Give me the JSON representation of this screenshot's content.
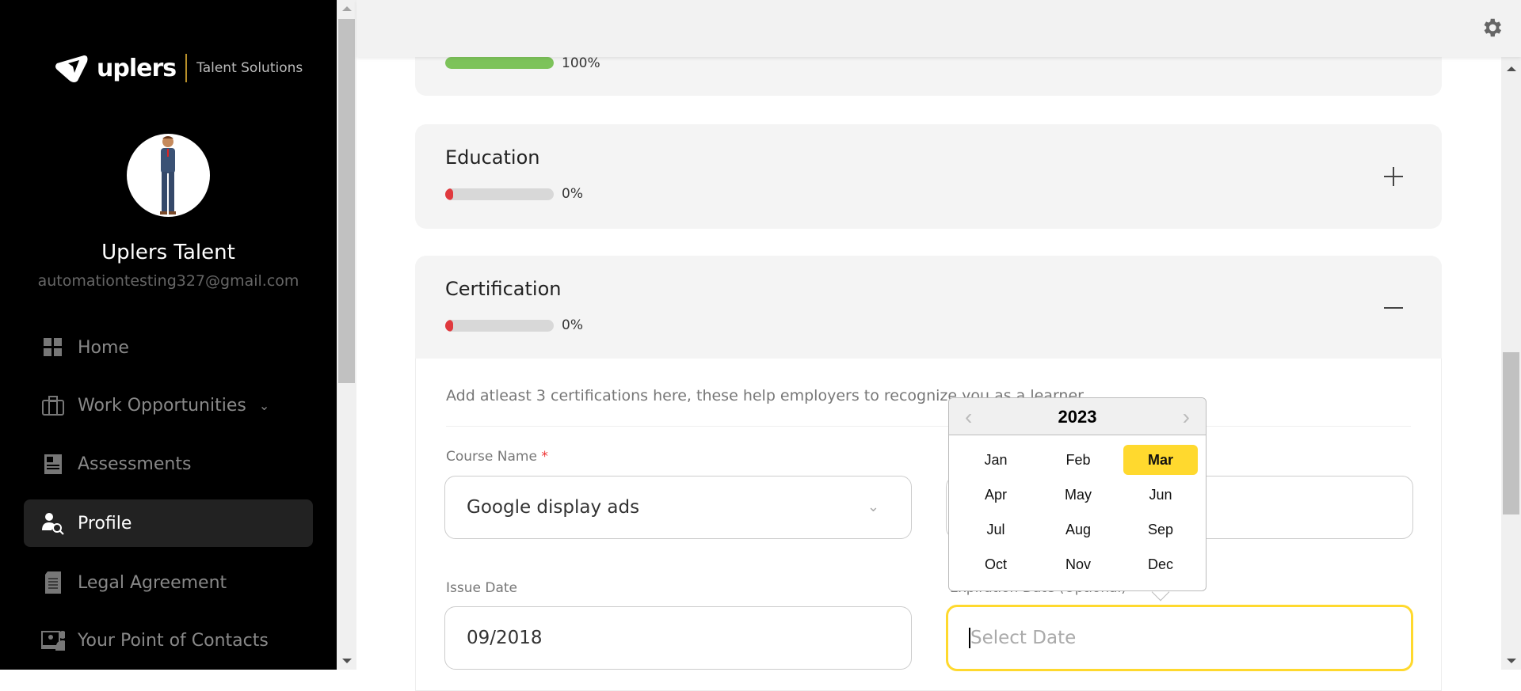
{
  "brand": {
    "name": "uplers",
    "tagline": "Talent Solutions"
  },
  "user": {
    "name": "Uplers Talent",
    "email": "automationtesting327@gmail.com"
  },
  "sidebar": {
    "items": [
      {
        "label": "Home",
        "icon": "grid-icon"
      },
      {
        "label": "Work Opportunities",
        "icon": "briefcase-icon"
      },
      {
        "label": "Assessments",
        "icon": "assessment-icon"
      },
      {
        "label": "Profile",
        "icon": "profile-search-icon",
        "active": true
      },
      {
        "label": "Legal Agreement",
        "icon": "document-icon"
      },
      {
        "label": "Your Point of Contacts",
        "icon": "contacts-icon"
      }
    ]
  },
  "sections": {
    "previous": {
      "percent_label": "100%",
      "progress": 100
    },
    "education": {
      "title": "Education",
      "percent_label": "0%",
      "progress": 0
    },
    "certification": {
      "title": "Certification",
      "percent_label": "0%",
      "progress": 0
    }
  },
  "certification_form": {
    "description": "Add atleast 3 certifications here, these help employers to recognize you as a learner",
    "course_name_label": "Course Name",
    "required_mark": "*",
    "course_name_value": "Google display ads",
    "issue_date_label": "Issue Date",
    "issue_date_value": "09/2018",
    "expiration_date_label": "Expiration Date (Optional)",
    "expiration_date_placeholder": "Select Date"
  },
  "month_picker": {
    "year": "2023",
    "months": [
      "Jan",
      "Feb",
      "Mar",
      "Apr",
      "May",
      "Jun",
      "Jul",
      "Aug",
      "Sep",
      "Oct",
      "Nov",
      "Dec"
    ],
    "selected": "Mar"
  },
  "colors": {
    "accent": "#ffd92e",
    "progress_full": "#7dc35a",
    "progress_empty": "#e0393e",
    "sidebar_bg": "#000000"
  }
}
